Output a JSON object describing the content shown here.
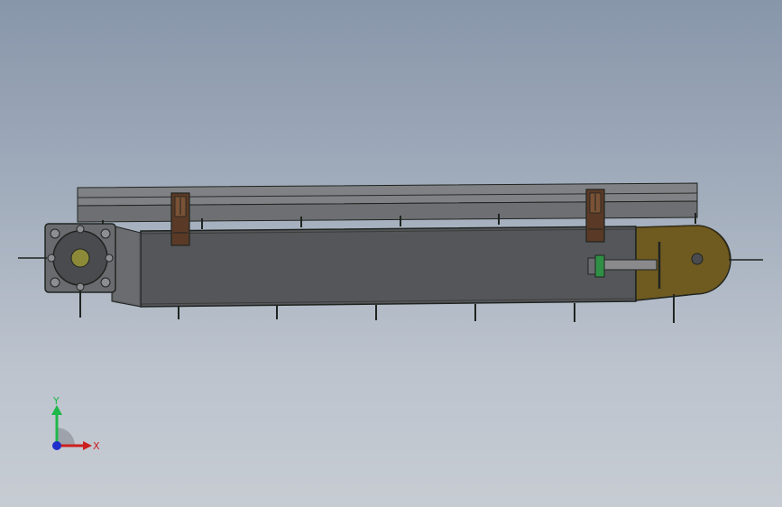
{
  "viewport": {
    "background_top": "#8896aa",
    "background_bottom": "#c7ccd3"
  },
  "model": {
    "description_icon": "belt-conveyor-model",
    "colors": {
      "frame_body": "#56575a",
      "frame_outline": "#1f2420",
      "top_rail": "#7f8084",
      "bracket": "#5a3a26",
      "idler_end": "#6f5a20",
      "drive_head": "#6b6c6e",
      "tension_bolt": "#8a8a8c",
      "bolt_nut": "#2f8f45"
    }
  },
  "triad": {
    "y_label": "Y",
    "x_label": "X",
    "colors": {
      "x": "#cc1f1f",
      "y": "#1fb84a",
      "z": "#1f2fcc"
    }
  }
}
